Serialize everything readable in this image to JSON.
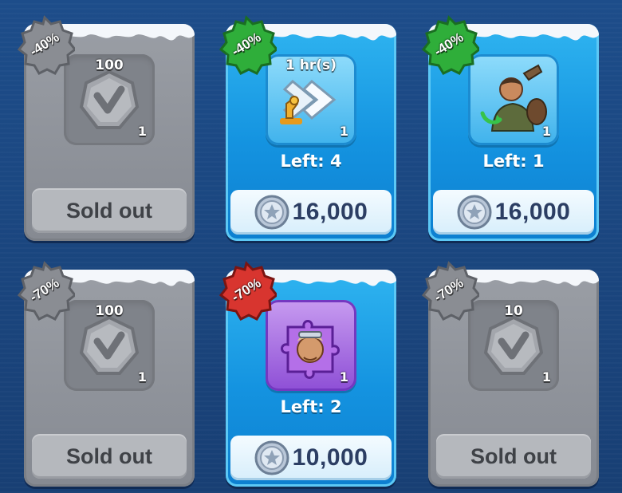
{
  "shop": {
    "items": [
      {
        "discount": "-40%",
        "badge_color": "#8a8d93",
        "state": "sold",
        "top_label": "100",
        "quantity": "1",
        "icon": "hexagon-rank-icon",
        "button": "Sold out"
      },
      {
        "discount": "-40%",
        "badge_color": "#2fae3a",
        "state": "active",
        "top_label": "1 hr(s)",
        "quantity": "1",
        "icon": "research-speedup-icon",
        "left_text": "Left: 4",
        "price": "16,000"
      },
      {
        "discount": "-40%",
        "badge_color": "#2fae3a",
        "state": "active",
        "top_label": "",
        "quantity": "1",
        "icon": "soldier-hero-icon",
        "left_text": "Left: 1",
        "price": "16,000"
      },
      {
        "discount": "-70%",
        "badge_color": "#8a8d93",
        "state": "sold",
        "top_label": "100",
        "quantity": "1",
        "icon": "hexagon-rank-icon",
        "button": "Sold out"
      },
      {
        "discount": "-70%",
        "badge_color": "#d8352f",
        "state": "active",
        "top_label": "",
        "quantity": "1",
        "icon": "hero-puzzle-piece-icon",
        "left_text": "Left: 2",
        "price": "10,000"
      },
      {
        "discount": "-70%",
        "badge_color": "#8a8d93",
        "state": "sold",
        "top_label": "10",
        "quantity": "1",
        "icon": "hexagon-rank-icon",
        "button": "Sold out"
      }
    ]
  },
  "colors": {
    "background": "#1c4a85",
    "card_active": "#1493e0",
    "card_sold": "#868a92",
    "price_text": "#2c3e63"
  }
}
